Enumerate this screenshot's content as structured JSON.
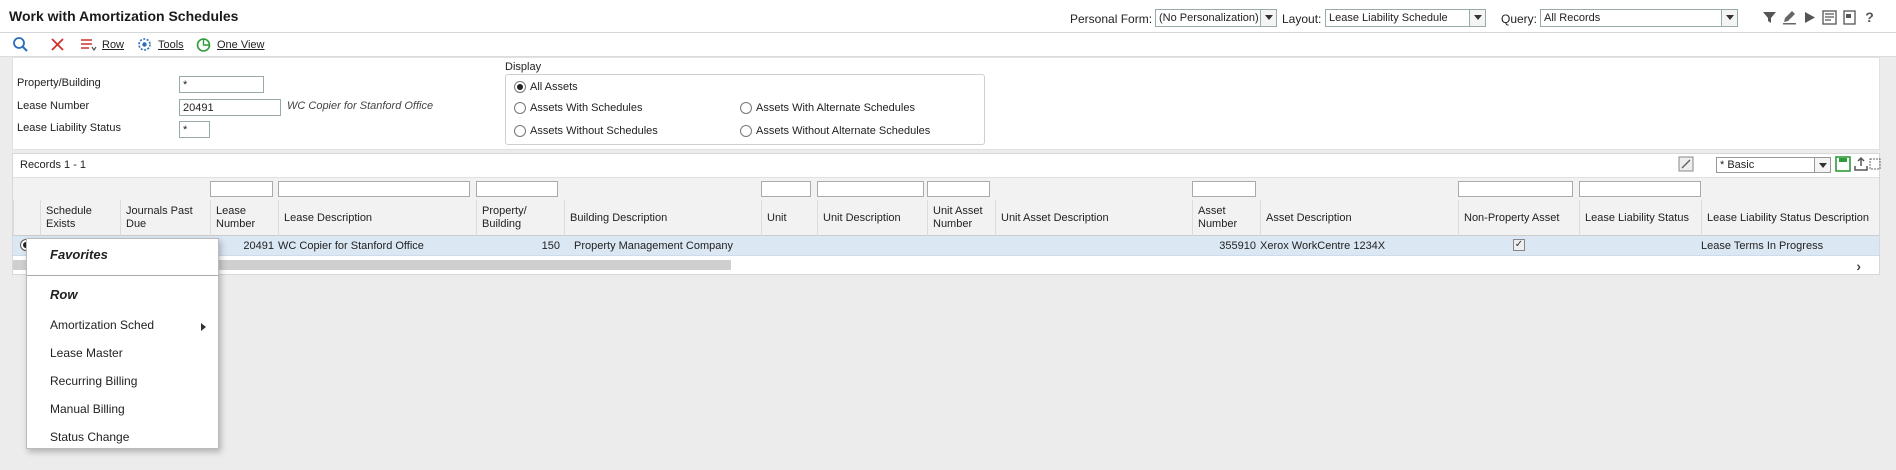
{
  "header": {
    "title": "Work with Amortization Schedules",
    "personal_form_label": "Personal Form:",
    "personal_form_value": "(No Personalization)",
    "layout_label": "Layout:",
    "layout_value": "Lease Liability Schedule",
    "query_label": "Query:",
    "query_value": "All Records",
    "icons": [
      "filter-icon",
      "pencil-icon",
      "play-icon",
      "list-icon",
      "document-icon",
      "help-icon"
    ]
  },
  "toolbar": {
    "find_icon": "search-icon",
    "delete_icon": "close-icon",
    "row_label": "Row",
    "tools_label": "Tools",
    "one_view_label": "One View"
  },
  "criteria": {
    "property_building_label": "Property/Building",
    "property_building_value": "*",
    "lease_number_label": "Lease Number",
    "lease_number_value": "20491",
    "lease_number_desc": "WC Copier for Stanford Office",
    "lease_liability_status_label": "Lease Liability Status",
    "lease_liability_status_value": "*"
  },
  "display": {
    "title": "Display",
    "options": [
      {
        "label": "All Assets",
        "selected": true
      },
      {
        "label": "Assets With Schedules",
        "selected": false
      },
      {
        "label": "Assets With Alternate Schedules",
        "selected": false
      },
      {
        "label": "Assets Without Schedules",
        "selected": false
      },
      {
        "label": "Assets Without Alternate Schedules",
        "selected": false
      }
    ]
  },
  "grid": {
    "records_label": "Records 1 - 1",
    "view_select": "* Basic",
    "columns": [
      "Schedule Exists",
      "Journals Past Due",
      "Lease Number",
      "Lease Description",
      "Property/ Building",
      "Building Description",
      "Unit",
      "Unit Description",
      "Unit Asset Number",
      "Unit Asset Description",
      "Asset Number",
      "Asset Description",
      "Non-Property Asset",
      "Lease Liability Status",
      "Lease Liability Status Description"
    ],
    "row": {
      "lease_number": "20491",
      "lease_description": "WC Copier for Stanford Office",
      "property_building": "150",
      "building_description": "Property Management Company",
      "asset_number": "355910",
      "asset_description": "Xerox WorkCentre 1234X",
      "non_property_asset": true,
      "lease_liability_status_description": "Lease Terms In Progress"
    }
  },
  "context_menu": {
    "favorites": "Favorites",
    "row": "Row",
    "items": [
      "Amortization Sched",
      "Lease Master",
      "Recurring Billing",
      "Manual Billing",
      "Status Change"
    ]
  },
  "colors": {
    "selected_row": "#dbe7f3",
    "background": "#ececec",
    "accent_green": "#2e9b3a",
    "accent_red": "#d0312d",
    "accent_blue": "#2a6ebb"
  }
}
